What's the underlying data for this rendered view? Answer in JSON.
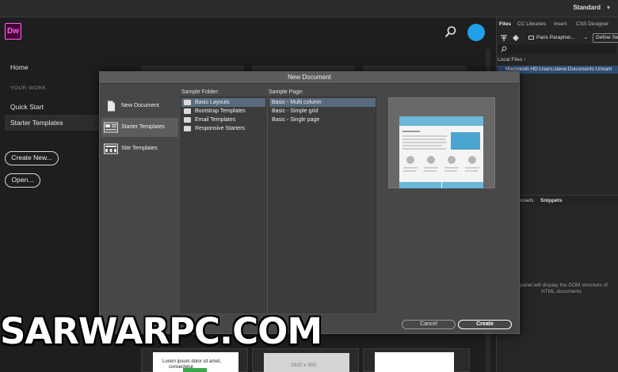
{
  "app": {
    "logo": "Dw",
    "workspace": "Standard"
  },
  "home": {
    "nav_home": "Home",
    "section_label": "YOUR WORK",
    "nav_quick_start": "Quick Start",
    "nav_starter_templates": "Starter Templates",
    "create_new": "Create New...",
    "open": "Open...",
    "bottom_card_text1": "Lorem ipsum dolor sit amet,",
    "bottom_card_text2": "consectetur.",
    "bottom_card_size": "1920 x 500"
  },
  "right_panel": {
    "tabs": [
      "Files",
      "CC Libraries",
      "Insert",
      "CSS Designer"
    ],
    "site_name": "Paris Parapher...",
    "define_button": "Define Se",
    "local_files": "Local Files",
    "path": "Macintosh HD:Users:steve:Documents:Unnam",
    "lower_tab_assets": "Assets",
    "lower_tab_snippets": "Snippets",
    "dom_message_1": "panel will display the DOM structure of",
    "dom_message_2": "HTML documents"
  },
  "dialog": {
    "title": "New Document",
    "categories": [
      {
        "label": "New Document",
        "icon": "document-icon",
        "selected": false
      },
      {
        "label": "Starter Templates",
        "icon": "template-icon",
        "selected": true
      },
      {
        "label": "Site Templates",
        "icon": "site-template-icon",
        "selected": false
      }
    ],
    "sample_folder_label": "Sample Folder:",
    "sample_folders": [
      "Basic Layouts",
      "Bootstrap Templates",
      "Email Templates",
      "Responsive Starters"
    ],
    "sample_page_label": "Sample Page:",
    "sample_pages": [
      "Basic - Multi column",
      "Basic - Simple grid",
      "Basic - Single page"
    ],
    "cancel": "Cancel",
    "create": "Create",
    "ghost_cancel": "Cance"
  },
  "watermark": "SARWARPC.COM",
  "colors": {
    "accent_dw": "#ff61f6",
    "avatar": "#1fa0e8",
    "selection": "#5a6a7e",
    "preview_blue": "#6ab7d8"
  }
}
